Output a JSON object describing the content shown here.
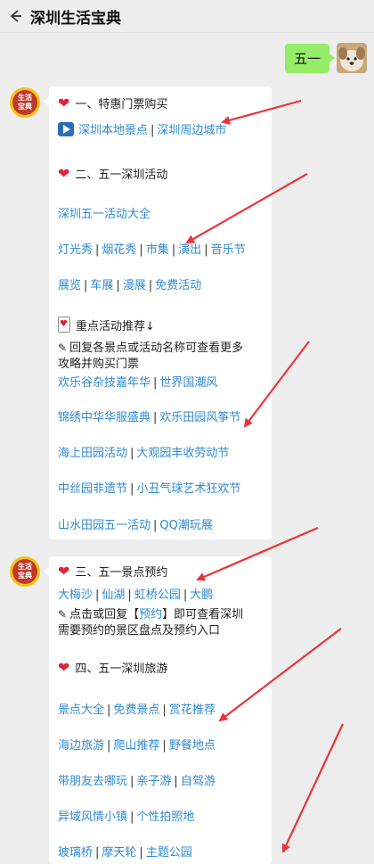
{
  "header": {
    "title": "深圳生活宝典"
  },
  "user_message": "五一",
  "bot_avatar_text": [
    "生活",
    "宝典"
  ],
  "card1": {
    "h1": "一、特惠门票购买",
    "h1_links": [
      "深圳本地景点",
      "深圳周边城市"
    ],
    "h2": "二、五一深圳活动",
    "row1": [
      "深圳五一活动大全"
    ],
    "row2": [
      "灯光秀",
      "烟花秀",
      "市集",
      "演出",
      "音乐节"
    ],
    "row3": [
      "展览",
      "车展",
      "漫展",
      "免费活动"
    ],
    "h3": "重点活动推荐↓",
    "note1": "回复各景点或活动名称可查看更多",
    "note2": "攻略并购买门票",
    "row4": [
      "欢乐谷杂技嘉年华",
      "世界国潮风"
    ],
    "row5": [
      "锦绣中华华服盛典",
      "欢乐田园风筝节"
    ],
    "row6": [
      "海上田园活动",
      "大观园丰收劳动节"
    ],
    "row7": [
      "中丝园非遗节",
      "小丑气球艺术狂欢节"
    ],
    "row8": [
      "山水田园五一活动",
      "QQ潮玩展"
    ]
  },
  "card2": {
    "h1": "三、五一景点预约",
    "row1": [
      "大梅沙",
      "仙湖",
      "虹桥公园",
      "大鹏"
    ],
    "note_prefix": "点击或回复【",
    "note_link": "预约",
    "note_suffix": "】即可查看深圳",
    "note2": "需要预约的景区盘点及预约入口",
    "h2": "四、五一深圳旅游",
    "row2": [
      "景点大全",
      "免费景点",
      "赏花推荐"
    ],
    "row3": [
      "海边旅游",
      "爬山推荐",
      "野餐地点"
    ],
    "row4": [
      "带朋友去哪玩",
      "亲子游",
      "自驾游"
    ],
    "row5": [
      "异域风情小镇",
      "个性拍照地"
    ],
    "row6": [
      "玻璃桥",
      "摩天轮",
      "主题公园"
    ]
  },
  "colors": {
    "link": "#2f8ad1",
    "bubble": "#95ec69",
    "arrow": "#e8353a"
  }
}
